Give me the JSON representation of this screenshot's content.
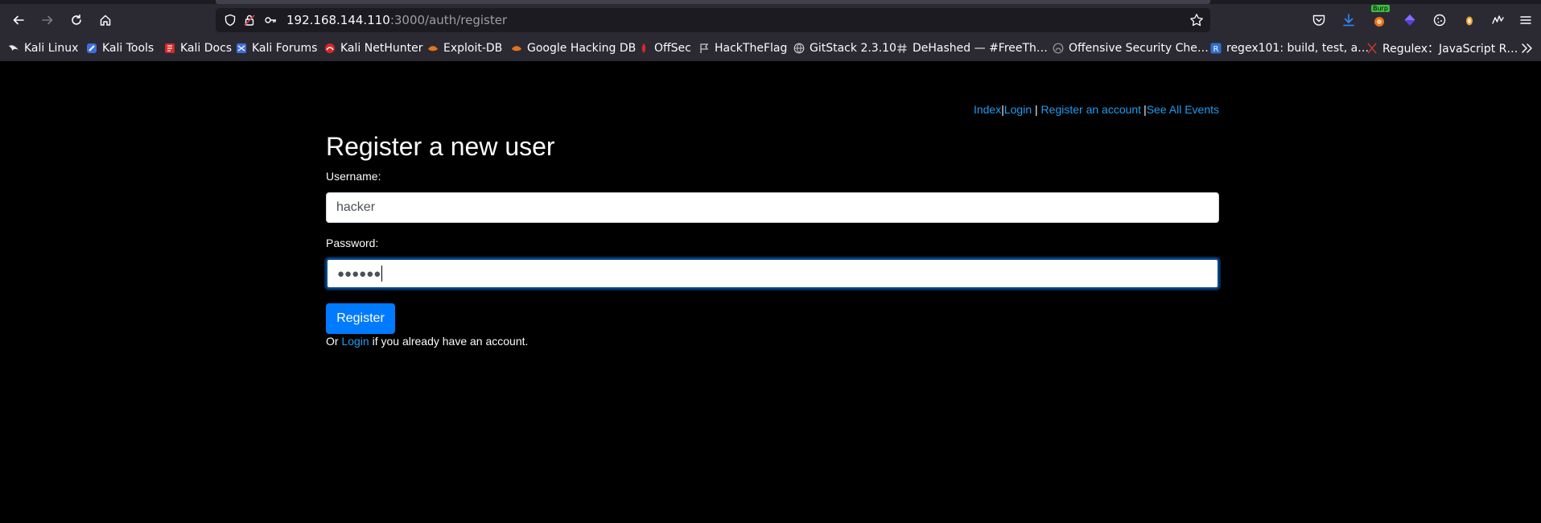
{
  "browser": {
    "url_host": "192.168.144.110",
    "url_path": ":3000/auth/register",
    "bookmarks": [
      {
        "label": "Kali Linux",
        "icon": "kali-dragon-icon",
        "color": "#e8e8e8"
      },
      {
        "label": "Kali Tools",
        "icon": "kali-tools-icon",
        "color": "#3d6fe0"
      },
      {
        "label": "Kali Docs",
        "icon": "kali-docs-icon",
        "color": "#d62828"
      },
      {
        "label": "Kali Forums",
        "icon": "kali-forums-icon",
        "color": "#3d6fe0"
      },
      {
        "label": "Kali NetHunter",
        "icon": "nethunter-icon",
        "color": "#d62828"
      },
      {
        "label": "Exploit-DB",
        "icon": "exploit-db-icon",
        "color": "#e8731a"
      },
      {
        "label": "Google Hacking DB",
        "icon": "ghdb-icon",
        "color": "#e8731a"
      },
      {
        "label": "OffSec",
        "icon": "offsec-icon",
        "color": "#d62828"
      },
      {
        "label": "HackTheFlag",
        "icon": "flag-icon",
        "color": "#c8c8c8"
      },
      {
        "label": "GitStack 2.3.10",
        "icon": "globe-icon",
        "color": "#c8c8c8"
      },
      {
        "label": "DeHashed — #FreeTh…",
        "icon": "hash-icon",
        "color": "#c8c8c8"
      },
      {
        "label": "Offensive Security Che…",
        "icon": "offsec-cheat-icon",
        "color": "#9a9a9a"
      },
      {
        "label": "regex101: build, test, a…",
        "icon": "regex101-icon",
        "color": "#2f6fd0"
      },
      {
        "label": "Regulex：JavaScript R…",
        "icon": "regulex-icon",
        "color": "#c0392b"
      }
    ],
    "burp_badge": "Burp"
  },
  "nav": {
    "index": "Index",
    "login": "Login",
    "register": "Register an account",
    "events": "See All Events",
    "sep_pipe": "|",
    "sep_pipe_spaced": " | "
  },
  "form": {
    "title": "Register a new user",
    "username_label": "Username:",
    "username_value": "hacker",
    "password_label": "Password:",
    "password_value": "●●●●●●",
    "submit_label": "Register",
    "footer_prefix": "Or ",
    "footer_link": "Login",
    "footer_suffix": " if you already have an account."
  }
}
